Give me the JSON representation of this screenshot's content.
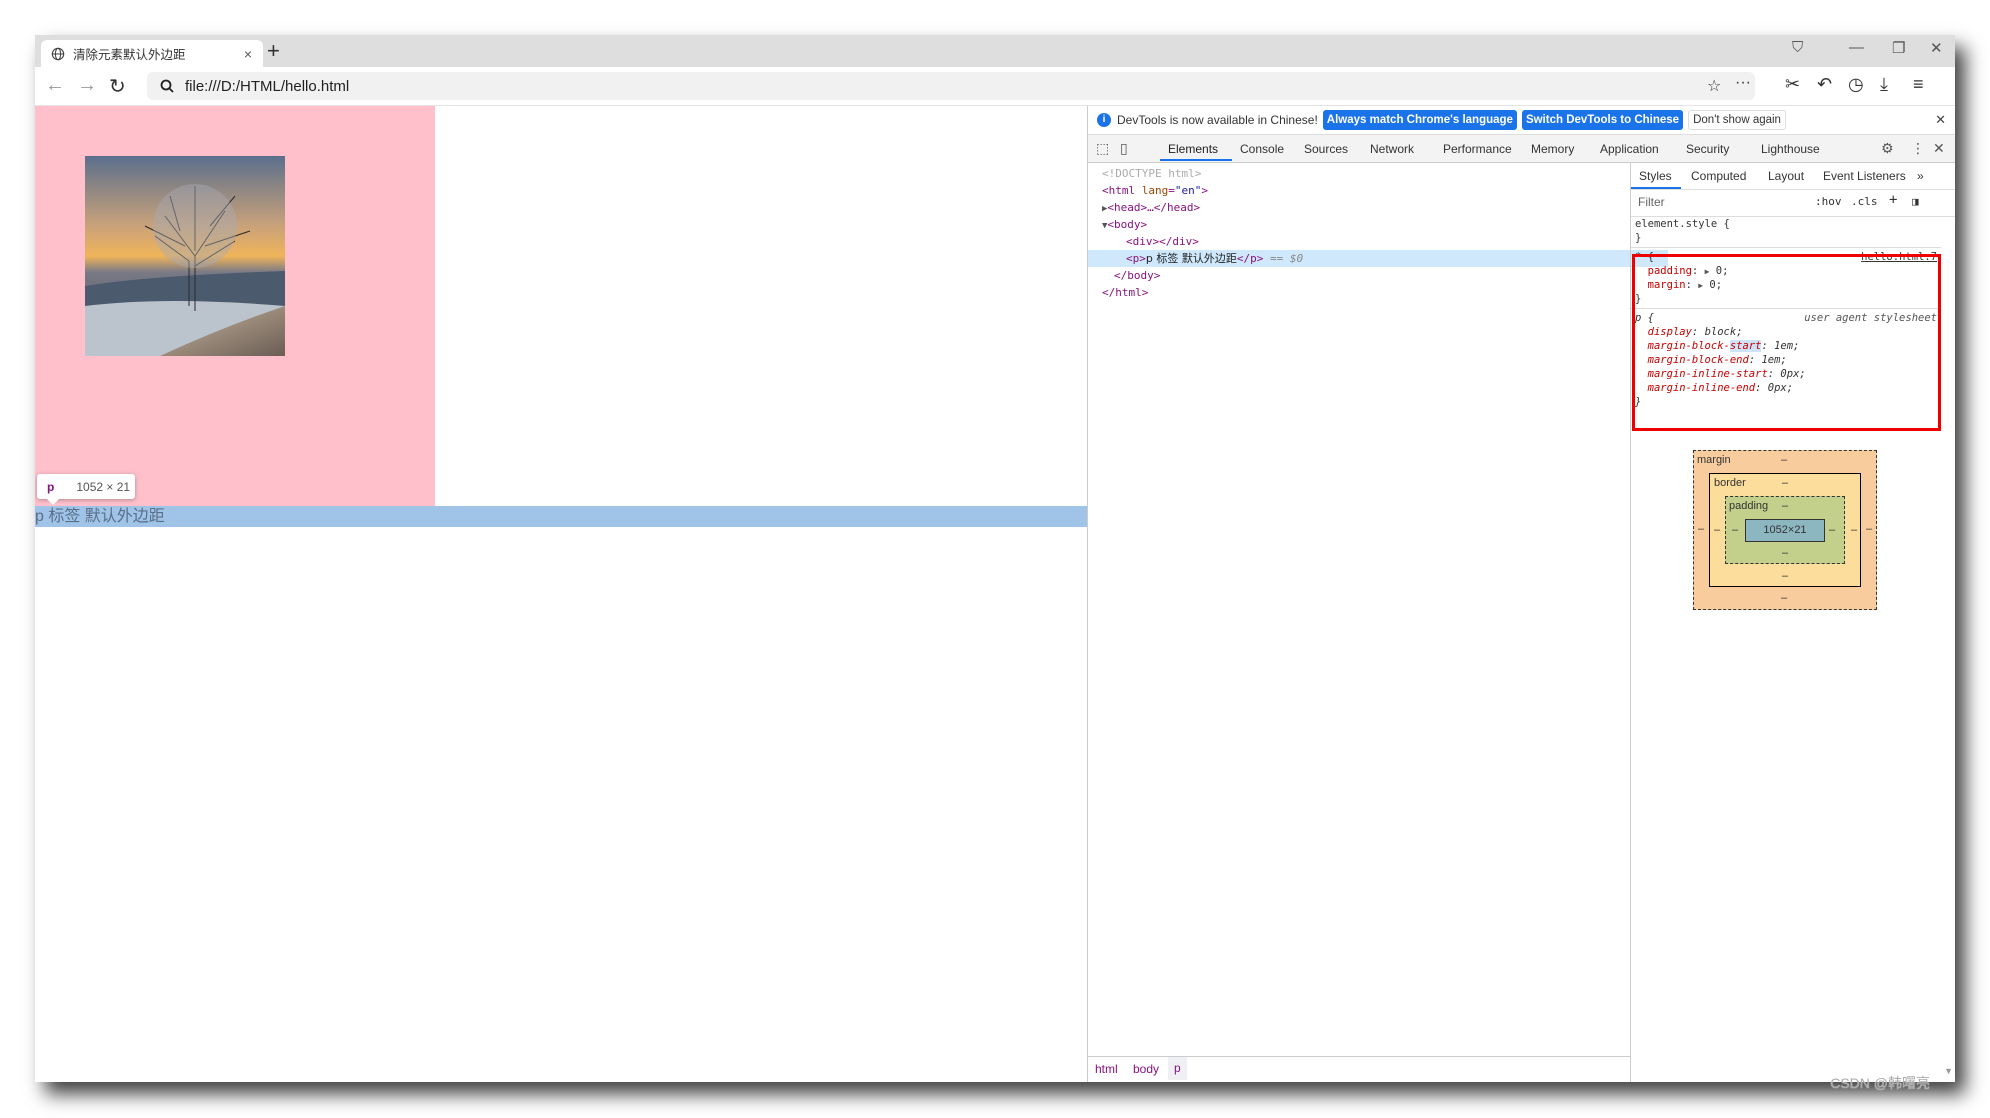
{
  "browser": {
    "tab_title": "清除元素默认外边距",
    "tab_close": "×",
    "new_tab": "+",
    "url": "file:///D:/HTML/hello.html"
  },
  "page": {
    "paragraph_text": "p 标签 默认外边距",
    "tooltip": {
      "tag": "p",
      "dims": "1052 × 21"
    },
    "colors": {
      "div_background": "#ffc0cb",
      "highlight": "#9fc4e7"
    }
  },
  "devtools": {
    "infobar": {
      "message": "DevTools is now available in Chinese!",
      "btn_match": "Always match Chrome's language",
      "btn_switch": "Switch DevTools to Chinese",
      "btn_dismiss": "Don't show again"
    },
    "tabs": [
      "Elements",
      "Console",
      "Sources",
      "Network",
      "Performance",
      "Memory",
      "Application",
      "Security",
      "Lighthouse"
    ],
    "active_tab": "Elements",
    "dom": {
      "doctype": "<!DOCTYPE html>",
      "html_open": "<html ",
      "html_attr": "lang",
      "html_val": "\"en\"",
      "head": "<head>…</head>",
      "body_open": "<body>",
      "div": "<div></div>",
      "p_open": "<p>",
      "p_text": "p 标签 默认外边距",
      "p_close": "</p>",
      "p_eq": " == $0",
      "body_close": "</body>",
      "html_close": "</html>"
    },
    "breadcrumb": [
      "html",
      "body",
      "p"
    ],
    "styles": {
      "tabs": [
        "Styles",
        "Computed",
        "Layout",
        "Event Listeners",
        "»"
      ],
      "filter_placeholder": "Filter",
      "hov": ":hov",
      "cls": ".cls",
      "element_style": "element.style {",
      "close_brace": "}",
      "universal_rule": {
        "selector": "* {",
        "source": "hello.html:7",
        "props": [
          {
            "name": "padding",
            "value": "0"
          },
          {
            "name": "margin",
            "value": "0"
          }
        ]
      },
      "p_rule": {
        "selector": "p {",
        "source": "user agent stylesheet",
        "props": [
          {
            "name": "display",
            "value": "block"
          },
          {
            "name": "margin-block-start",
            "value": "1em"
          },
          {
            "name": "margin-block-end",
            "value": "1em"
          },
          {
            "name": "margin-inline-start",
            "value": "0px"
          },
          {
            "name": "margin-inline-end",
            "value": "0px"
          }
        ]
      }
    },
    "box_model": {
      "margin_label": "margin",
      "border_label": "border",
      "padding_label": "padding",
      "content": "1052×21",
      "dash": "–"
    }
  },
  "watermark": "CSDN @韩曙亮"
}
